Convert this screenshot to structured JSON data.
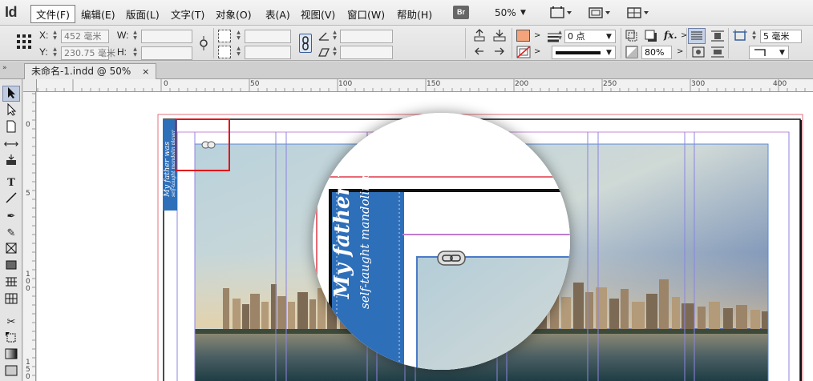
{
  "app": {
    "logo": "Id",
    "menus": [
      "文件(F)",
      "编辑(E)",
      "版面(L)",
      "文字(T)",
      "对象(O)",
      "表(A)",
      "视图(V)",
      "窗口(W)",
      "帮助(H)"
    ],
    "bridge_label": "Br",
    "zoom": "50%"
  },
  "control_panel": {
    "x_label": "X:",
    "x_value": "452 毫米",
    "y_label": "Y:",
    "y_value": "230.75 毫米",
    "w_label": "W:",
    "w_value": "",
    "h_label": "H:",
    "h_value": "",
    "stroke_weight": "0 点",
    "gap_value": "5 毫米",
    "opacity": "80%",
    "fill_color": "#f5a37a",
    "fx_label": "fx."
  },
  "document": {
    "tab_title": "未命名-1.indd @ 50%",
    "close_glyph": "×",
    "ruler_top_labels": [
      "0",
      "50",
      "100",
      "150",
      "200",
      "250",
      "300",
      "350",
      "400"
    ],
    "ruler_left_labels": [
      "0",
      "5",
      "1\n0\n0",
      "1\n5\n0"
    ]
  },
  "artwork": {
    "line1": "My father was",
    "line2": "self-taught mandolin player",
    "label_color": "#2e6fba"
  }
}
